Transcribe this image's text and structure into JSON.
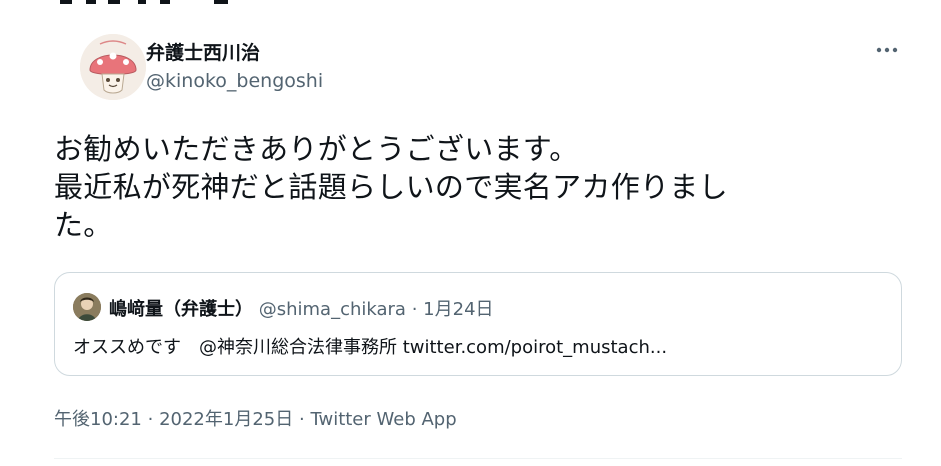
{
  "tweet": {
    "author": {
      "display_name": "弁護士西川治",
      "handle": "@kinoko_bengoshi",
      "avatar_icon": "mushroom-avatar-icon"
    },
    "more_icon": "more-options-icon",
    "text_lines": [
      "お勧めいただきありがとうございます。",
      "最近私が死神だと話題らしいので実名アカ作りまし",
      "た。"
    ],
    "quote": {
      "display_name": "嶋﨑量（弁護士）",
      "handle": "@shima_chikara",
      "separator": "·",
      "date": "1月24日",
      "text": "オススめです　@神奈川総合法律事務所 twitter.com/poirot_mustach..."
    },
    "meta": {
      "time": "午後10:21",
      "separator": "·",
      "date": "2022年1月25日",
      "separator2": "·",
      "source": "Twitter Web App"
    }
  },
  "colors": {
    "text_primary": "#0f1419",
    "text_secondary": "#536471",
    "border": "#cfd9de"
  }
}
